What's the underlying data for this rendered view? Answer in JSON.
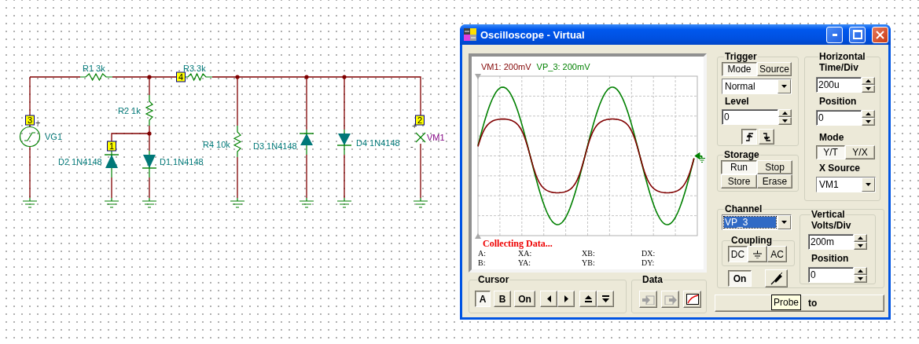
{
  "schematic": {
    "components": [
      {
        "kind": "source",
        "label": "VG1"
      },
      {
        "kind": "resistor",
        "label": "R1 3k"
      },
      {
        "kind": "resistor",
        "label": "R3 3k"
      },
      {
        "kind": "resistor",
        "label": "R2 1k"
      },
      {
        "kind": "diode",
        "label": "D2 1N4148"
      },
      {
        "kind": "diode",
        "label": "D1 1N4148"
      },
      {
        "kind": "resistor",
        "label": "R4 10k"
      },
      {
        "kind": "diode",
        "label": "D3 1N4148"
      },
      {
        "kind": "diode",
        "label": "D4 1N4148"
      },
      {
        "kind": "voltmeter",
        "label": "VM1"
      }
    ],
    "nodes": [
      "3",
      "4",
      "1",
      "2"
    ],
    "marks": [
      "+",
      "+",
      "-"
    ]
  },
  "window": {
    "title": "Oscilloscope - Virtual"
  },
  "display": {
    "legend": [
      {
        "text": "VM1: 200mV",
        "color": "#800000"
      },
      {
        "text": "VP_3: 200mV",
        "color": "#008000"
      }
    ],
    "status": "Collecting Data...",
    "readouts": [
      "A:",
      "XA:",
      "XB:",
      "DX:",
      "B:",
      "YA:",
      "YB:",
      "DY:"
    ]
  },
  "cursor": {
    "title": "Cursor",
    "buttons": [
      {
        "kind": "text",
        "label": "A",
        "selected": true
      },
      {
        "kind": "text",
        "label": "B",
        "selected": false
      },
      {
        "kind": "text",
        "label": "On",
        "selected": false
      },
      {
        "kind": "left"
      },
      {
        "kind": "right"
      },
      {
        "kind": "up"
      },
      {
        "kind": "down"
      }
    ]
  },
  "data": {
    "title": "Data",
    "buttons": [
      {
        "kind": "import",
        "disabled": true
      },
      {
        "kind": "export",
        "disabled": true
      },
      {
        "kind": "graph",
        "disabled": false
      }
    ]
  },
  "trigger": {
    "title": "Trigger",
    "tabs": [
      {
        "label": "Mode",
        "selected": true
      },
      {
        "label": "Source",
        "selected": false
      }
    ],
    "mode_value": "Normal",
    "level_label": "Level",
    "level_value": "0",
    "edges": [
      {
        "kind": "rising",
        "selected": true
      },
      {
        "kind": "falling",
        "selected": false
      }
    ]
  },
  "storage": {
    "title": "Storage",
    "buttons": [
      {
        "label": "Run",
        "selected": true
      },
      {
        "label": "Stop",
        "selected": false
      },
      {
        "label": "Store",
        "selected": false
      },
      {
        "label": "Erase",
        "selected": false
      }
    ]
  },
  "horizontal": {
    "title": "Horizontal",
    "time_label": "Time/Div",
    "time_value": "200u",
    "position_label": "Position",
    "position_value": "0",
    "mode_label": "Mode",
    "modes": [
      {
        "label": "Y/T",
        "selected": true
      },
      {
        "label": "Y/X",
        "selected": false
      }
    ],
    "source_label": "X Source",
    "source_value": "VM1"
  },
  "channel": {
    "title": "Channel",
    "value": "VP_3",
    "value_highlighted": true,
    "coupling_title": "Coupling",
    "coupling": [
      {
        "kind": "text",
        "label": "DC",
        "selected": true
      },
      {
        "kind": "ground",
        "selected": false
      },
      {
        "kind": "text",
        "label": "AC",
        "selected": false
      }
    ],
    "on_button": {
      "label": "On",
      "selected": true
    },
    "probe_button": {
      "selected": false
    }
  },
  "vertical": {
    "title": "Vertical",
    "volts_label": "Volts/Div",
    "volts_value": "200m",
    "position_label": "Position",
    "position_value": "0"
  },
  "auto_button": {
    "label": "to"
  },
  "tooltip": {
    "text": "Probe"
  }
}
